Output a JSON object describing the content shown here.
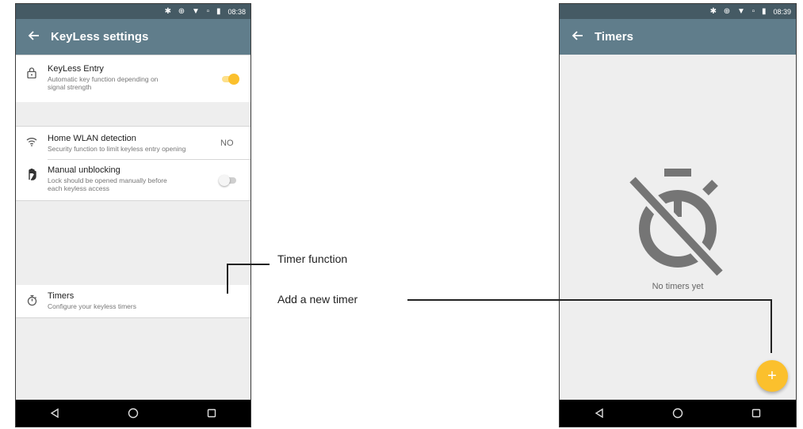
{
  "colors": {
    "statusbar": "#455a64",
    "appbar": "#607d8b",
    "accent": "#fbc02d",
    "navbar": "#000000"
  },
  "left_screen": {
    "status": {
      "time": "08:38",
      "icons": "✱ ⊕ ▼ ▫ ▮"
    },
    "appbar": {
      "back_icon": "arrow-left-icon",
      "title": "KeyLess settings"
    },
    "settings": {
      "keyless_entry": {
        "icon": "lock-icon",
        "title": "KeyLess Entry",
        "subtitle_line1": "Automatic key function depending on",
        "subtitle_line2": "signal strength",
        "toggle_on": true
      },
      "home_wlan": {
        "icon": "wifi-icon",
        "title": "Home WLAN detection",
        "subtitle": "Security function to limit keyless entry opening",
        "value": "NO"
      },
      "manual_unblocking": {
        "icon": "hand-icon",
        "title": "Manual unblocking",
        "subtitle_line1": "Lock should be opened manually before",
        "subtitle_line2": "each keyless access",
        "toggle_on": false
      },
      "timers": {
        "icon": "stopwatch-icon",
        "title": "Timers",
        "subtitle": "Configure your keyless timers"
      }
    }
  },
  "right_screen": {
    "status": {
      "time": "08:39",
      "icons": "✱ ⊕ ▼ ▫ ▮"
    },
    "appbar": {
      "back_icon": "arrow-left-icon",
      "title": "Timers"
    },
    "empty_state": {
      "icon": "timer-off-icon",
      "text": "No timers yet"
    },
    "fab": {
      "icon": "plus-icon",
      "label": "+"
    }
  },
  "annotations": {
    "timer_function": "Timer function",
    "add_timer": "Add a new timer"
  }
}
